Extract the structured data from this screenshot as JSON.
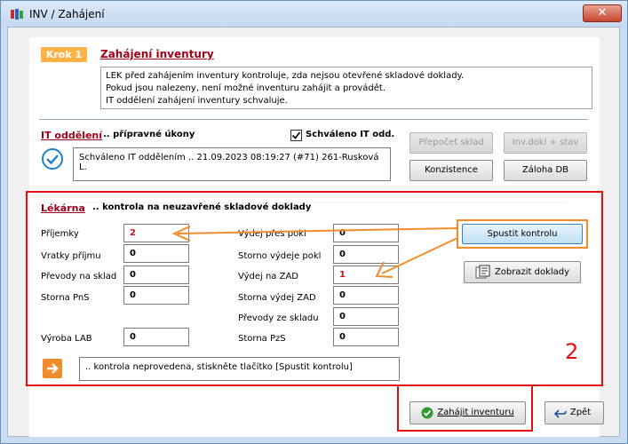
{
  "window": {
    "title": "INV / Zahájení",
    "close_label": "✕"
  },
  "step": {
    "badge": "Krok 1",
    "title": "Zahájení inventury",
    "description": [
      "LEK před zahájením inventury kontroluje, zda nejsou otevřené skladové doklady.",
      "Pokud jsou nalezeny, není možné inventuru zahájit a provádět.",
      "IT oddělení zahájení inventury schvaluje."
    ]
  },
  "it": {
    "heading": "IT oddělení",
    "subheading": ".. přípravné úkony",
    "approved_label": "Schváleno IT odd.",
    "approved_checked": true,
    "status_text": "Schváleno IT oddělením .. 21.09.2023 08:19:27 (#71) 261-Rusková L.",
    "buttons": {
      "prepocet": "Přepočet sklad",
      "inv_dokl": "Inv.dokl + stav",
      "konzistence": "Konzistence",
      "zaloha": "Záloha DB"
    }
  },
  "lekarna": {
    "heading": "Lékárna",
    "subheading": ".. kontrola na neuzavřené skladové doklady",
    "left_fields": [
      {
        "label": "Příjemky",
        "value": "2"
      },
      {
        "label": "Vratky příjmu",
        "value": "0"
      },
      {
        "label": "Převody na sklad",
        "value": "0"
      },
      {
        "label": "Storna PnS",
        "value": "0"
      },
      {
        "label": "Výroba LAB",
        "value": "0"
      }
    ],
    "right_fields": [
      {
        "label": "Výdej přes pokl",
        "value": "0"
      },
      {
        "label": "Storno výdeje pokl",
        "value": "0"
      },
      {
        "label": "Výdej na ZAD",
        "value": "1"
      },
      {
        "label": "Storna výdej ZAD",
        "value": "0"
      },
      {
        "label": "Převody ze skladu",
        "value": "0"
      },
      {
        "label": "Storna PzS",
        "value": "0"
      }
    ],
    "run_check_button": "Spustit kontrolu",
    "show_docs_button": "Zobrazit doklady",
    "status_text": ".. kontrola neprovedena, stiskněte tlačítko [Spustit kontrolu]"
  },
  "annotation_number": "2",
  "footer": {
    "start_button": "Zahájit inventuru",
    "back_button": "Zpět"
  },
  "colors": {
    "accent_red": "#e01010",
    "accent_orange": "#f08c2a",
    "value_red": "#d01010",
    "link_red": "#a0001a"
  }
}
